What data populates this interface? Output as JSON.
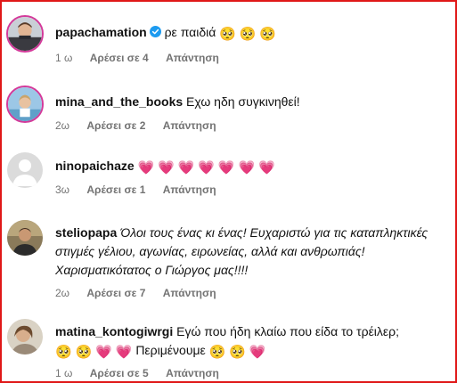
{
  "colors": {
    "frame_border": "#e01818",
    "muted_text": "#737373",
    "verified_blue": "#1d9bf0",
    "story_ring": "#d33a9a"
  },
  "comments": [
    {
      "username": "papachamation",
      "verified": true,
      "text": "ρε παιδιά",
      "emojis": [
        "🥺",
        "🥺",
        "🥺"
      ],
      "time": "1 ω",
      "likes": "Αρέσει σε 4",
      "reply": "Απάντηση",
      "avatar_icon": "profile-photo-icon"
    },
    {
      "username": "mina_and_the_books",
      "text": "Εχω ηδη συγκινηθεί!",
      "time": "2ω",
      "likes": "Αρέσει σε 2",
      "reply": "Απάντηση",
      "avatar_icon": "profile-photo-icon"
    },
    {
      "username": "ninopaichaze",
      "emojis": [
        "💗",
        "💗",
        "💗",
        "💗",
        "💗",
        "💗",
        "💗"
      ],
      "time": "3ω",
      "likes": "Αρέσει σε 1",
      "reply": "Απάντηση",
      "avatar_icon": "default-avatar-icon"
    },
    {
      "username": "steliopapa",
      "text": "Όλοι τους ένας κι ένας! Ευχαριστώ για τις καταπληκτικές στιγμές γέλιου, αγωνίας, ειρωνείας, αλλά και ανθρωπιάς! Χαρισματικότατος ο Γιώργος μας!!!!",
      "time": "2ω",
      "likes": "Αρέσει σε 7",
      "reply": "Απάντηση",
      "avatar_icon": "profile-photo-icon"
    },
    {
      "username": "matina_kontogiwrgi",
      "text": "Εγώ που ήδη κλαίω που είδα το τρέιλερ;",
      "emojis_a": [
        "🥺",
        "🥺",
        "💗",
        "💗"
      ],
      "text2": "Περιμένουμε",
      "emojis_b": [
        "🥺",
        "🥺",
        "💗"
      ],
      "time": "1 ω",
      "likes": "Αρέσει σε 5",
      "reply": "Απάντηση",
      "avatar_icon": "profile-photo-icon"
    }
  ]
}
